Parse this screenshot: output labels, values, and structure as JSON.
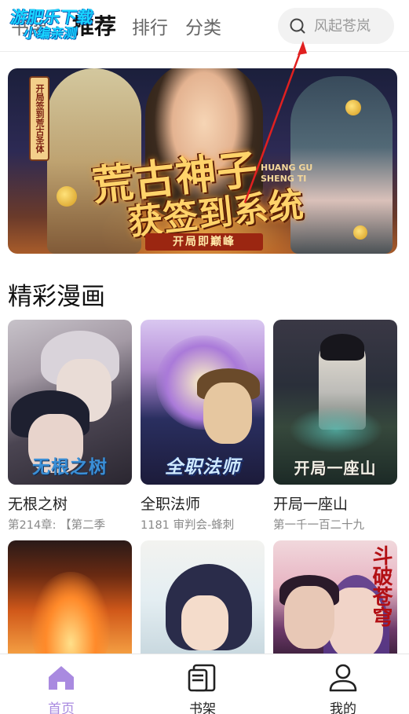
{
  "top_tabs": [
    {
      "label": "书架"
    },
    {
      "label": "推荐"
    },
    {
      "label": "排行"
    },
    {
      "label": "分类"
    }
  ],
  "watermark": {
    "line1": "游肥乐下载",
    "line2": "小编亲测"
  },
  "search": {
    "placeholder": "风起苍岚",
    "icon": "search-icon"
  },
  "banner": {
    "scroll_tag": "开局签到荒古圣体",
    "title_line1": "荒古神子",
    "title_line2": "获签到系统",
    "english": "HUANG GU SHENG TI",
    "subtitle": "开局即巅峰"
  },
  "section": {
    "title": "精彩漫画"
  },
  "comics": [
    {
      "title": "无根之树",
      "chapter": "第214章: 【第二季",
      "cover_text": "无根之树"
    },
    {
      "title": "全职法师",
      "chapter": "1181 审判会-蜂刺",
      "cover_text": "全职法师"
    },
    {
      "title": "开局一座山",
      "chapter": "第一千一百二十九",
      "cover_text": "开局一座山"
    },
    {
      "title": "",
      "chapter": "",
      "cover_text": ""
    },
    {
      "title": "",
      "chapter": "",
      "cover_text": ""
    },
    {
      "title": "",
      "chapter": "",
      "cover_text": "斗破苍穹"
    }
  ],
  "bottom_nav": [
    {
      "label": "首页",
      "icon": "home-icon",
      "active": true
    },
    {
      "label": "书架",
      "icon": "bookshelf-icon",
      "active": false
    },
    {
      "label": "我的",
      "icon": "profile-icon",
      "active": false
    }
  ],
  "colors": {
    "accent": "#a98ae0",
    "arrow": "#e02020",
    "text_primary": "#222222",
    "text_secondary": "#888888"
  }
}
